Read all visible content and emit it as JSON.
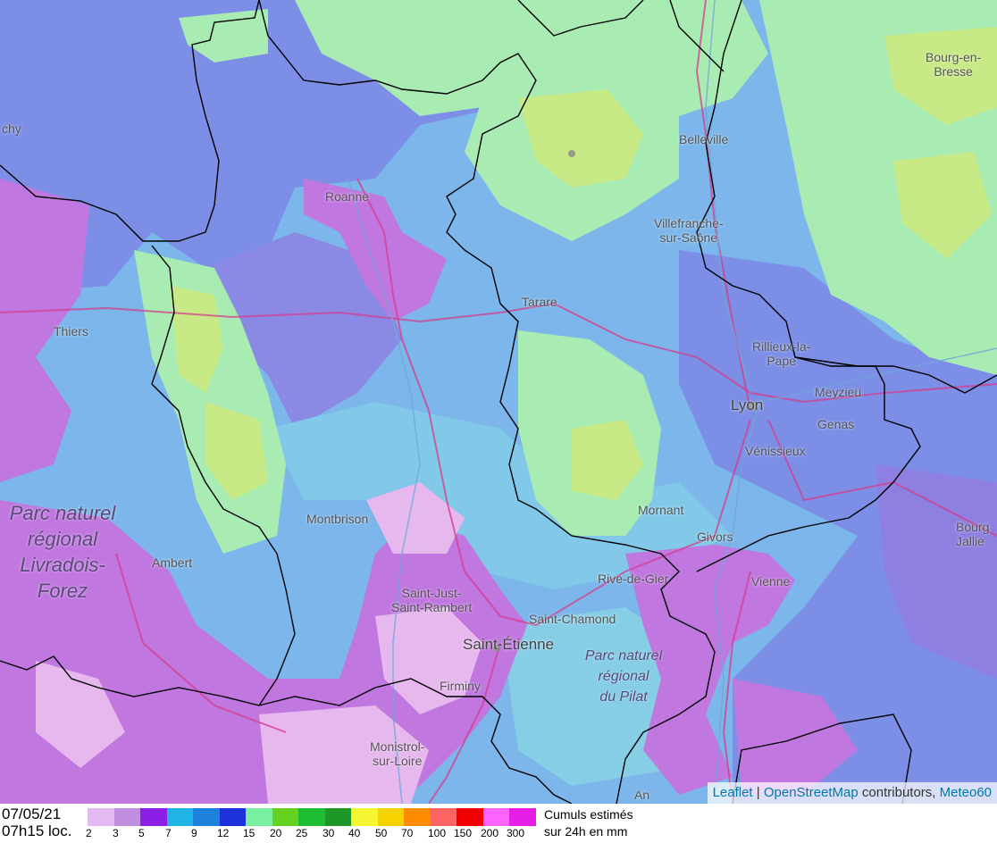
{
  "places": [
    {
      "key": "bourg_en_bresse",
      "label_lines": [
        "Bourg-en-",
        "Bresse"
      ]
    },
    {
      "key": "belleville",
      "label_lines": [
        "Belleville"
      ]
    },
    {
      "key": "roanne",
      "label_lines": [
        "Roanne"
      ]
    },
    {
      "key": "villefranche",
      "label_lines": [
        "Villefranche-",
        "sur-Saône"
      ]
    },
    {
      "key": "tarare",
      "label_lines": [
        "Tarare"
      ]
    },
    {
      "key": "thiers",
      "label_lines": [
        "Thiers"
      ]
    },
    {
      "key": "rillieux",
      "label_lines": [
        "Rillieux-la-",
        "Pape"
      ]
    },
    {
      "key": "meyzieu",
      "label_lines": [
        "Meyzieu"
      ]
    },
    {
      "key": "lyon",
      "label_lines": [
        "Lyon"
      ]
    },
    {
      "key": "genas",
      "label_lines": [
        "Genas"
      ]
    },
    {
      "key": "venissieux",
      "label_lines": [
        "Vénissieux"
      ]
    },
    {
      "key": "mornant",
      "label_lines": [
        "Mornant"
      ]
    },
    {
      "key": "givors",
      "label_lines": [
        "Givors"
      ]
    },
    {
      "key": "montbrison",
      "label_lines": [
        "Montbrison"
      ]
    },
    {
      "key": "ambert",
      "label_lines": [
        "Ambert"
      ]
    },
    {
      "key": "rive_de_gier",
      "label_lines": [
        "Rive-de-Gier"
      ]
    },
    {
      "key": "vienne",
      "label_lines": [
        "Vienne"
      ]
    },
    {
      "key": "saint_just",
      "label_lines": [
        "Saint-Just-",
        "Saint-Rambert"
      ]
    },
    {
      "key": "saint_chamond",
      "label_lines": [
        "Saint-Chamond"
      ]
    },
    {
      "key": "saint_etienne",
      "label_lines": [
        "Saint-Étienne"
      ]
    },
    {
      "key": "firminy",
      "label_lines": [
        "Firminy"
      ]
    },
    {
      "key": "monistrol",
      "label_lines": [
        "Monistrol-",
        "sur-Loire"
      ]
    },
    {
      "key": "bourg_jallieu",
      "label_lines": [
        "Bourg",
        "Jallie"
      ]
    },
    {
      "key": "chy",
      "label_lines": [
        "chy"
      ]
    },
    {
      "key": "an",
      "label_lines": [
        "An"
      ]
    }
  ],
  "parks": [
    {
      "key": "livradois",
      "label_lines": [
        "Parc naturel",
        "régional",
        "Livradois-",
        "Forez"
      ]
    },
    {
      "key": "pilat",
      "label_lines": [
        "Parc naturel",
        "régional",
        "du Pilat"
      ]
    }
  ],
  "attribution": {
    "leaflet": "Leaflet",
    "separator": " | ",
    "osm": "OpenStreetMap",
    "contributors": " contributors, ",
    "meteo": "Meteo60"
  },
  "legend": {
    "date": "07/05/21",
    "time": "07h15 loc.",
    "title_line1": "Cumuls estimés",
    "title_line2": "sur 24h en mm",
    "classes": [
      {
        "value": "2",
        "color": "#e3b9f2"
      },
      {
        "value": "3",
        "color": "#c08fe0"
      },
      {
        "value": "5",
        "color": "#8c1ee6"
      },
      {
        "value": "7",
        "color": "#1eb4e6"
      },
      {
        "value": "9",
        "color": "#1e82dc"
      },
      {
        "value": "12",
        "color": "#1e32dc"
      },
      {
        "value": "15",
        "color": "#78f0a0"
      },
      {
        "value": "20",
        "color": "#64d21e"
      },
      {
        "value": "25",
        "color": "#1ebe32"
      },
      {
        "value": "30",
        "color": "#1e9628"
      },
      {
        "value": "40",
        "color": "#f5f532"
      },
      {
        "value": "50",
        "color": "#f5d200"
      },
      {
        "value": "70",
        "color": "#ff8c00"
      },
      {
        "value": "100",
        "color": "#ff6464"
      },
      {
        "value": "150",
        "color": "#f00000"
      },
      {
        "value": "200",
        "color": "#ff64ff"
      },
      {
        "value": "300",
        "color": "#e61ee6"
      }
    ]
  },
  "colors": {
    "light_green": "#a8ecb4",
    "yellow_green": "#c8ea86",
    "blue": "#7c8ee6",
    "cyan": "#7cc4e8",
    "purple": "#c077e0",
    "pink_light": "#e6b8ee",
    "border": "#000000",
    "road": "#d63c8c",
    "river": "#6fa8d8"
  }
}
